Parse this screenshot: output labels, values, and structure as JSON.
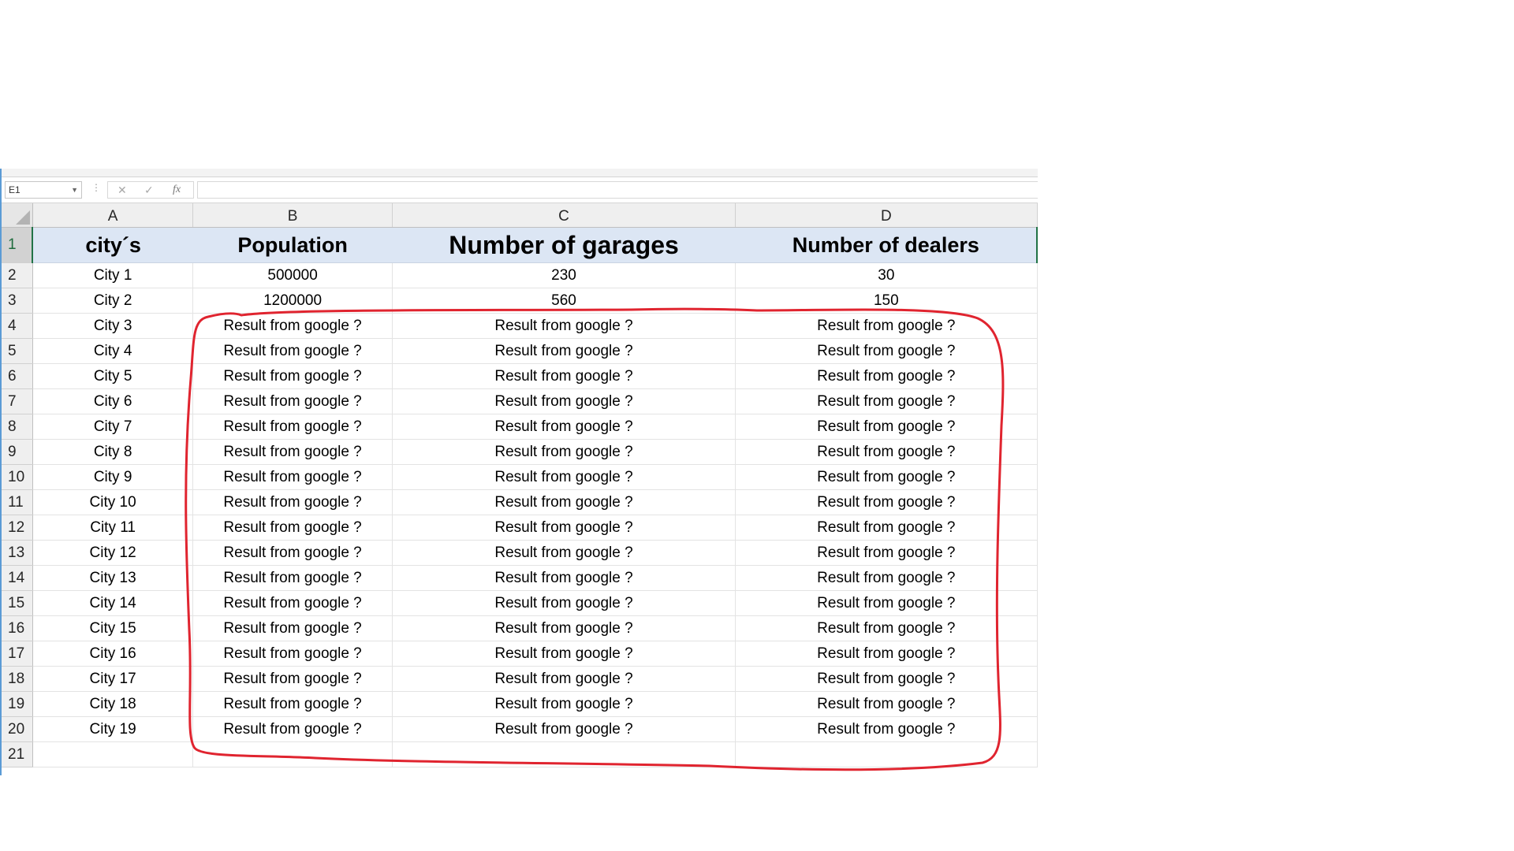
{
  "formula_bar": {
    "name_box": "E1",
    "cancel_glyph": "✕",
    "enter_glyph": "✓",
    "fx_label": "fx",
    "formula_value": ""
  },
  "sheet": {
    "columns": [
      "A",
      "B",
      "C",
      "D"
    ],
    "header_row": {
      "row_number": "1",
      "cells": [
        "city´s",
        "Population",
        "Number of garages",
        "Number of dealers"
      ]
    },
    "rows": [
      {
        "n": "2",
        "cells": [
          "City 1",
          "500000",
          "230",
          "30"
        ]
      },
      {
        "n": "3",
        "cells": [
          "City 2",
          "1200000",
          "560",
          "150"
        ]
      },
      {
        "n": "4",
        "cells": [
          "City 3",
          "Result from google ?",
          "Result from google ?",
          "Result from google ?"
        ]
      },
      {
        "n": "5",
        "cells": [
          "City 4",
          "Result from google ?",
          "Result from google ?",
          "Result from google ?"
        ]
      },
      {
        "n": "6",
        "cells": [
          "City 5",
          "Result from google ?",
          "Result from google ?",
          "Result from google ?"
        ]
      },
      {
        "n": "7",
        "cells": [
          "City 6",
          "Result from google ?",
          "Result from google ?",
          "Result from google ?"
        ]
      },
      {
        "n": "8",
        "cells": [
          "City 7",
          "Result from google ?",
          "Result from google ?",
          "Result from google ?"
        ]
      },
      {
        "n": "9",
        "cells": [
          "City 8",
          "Result from google ?",
          "Result from google ?",
          "Result from google ?"
        ]
      },
      {
        "n": "10",
        "cells": [
          "City 9",
          "Result from google ?",
          "Result from google ?",
          "Result from google ?"
        ]
      },
      {
        "n": "11",
        "cells": [
          "City 10",
          "Result from google ?",
          "Result from google ?",
          "Result from google ?"
        ]
      },
      {
        "n": "12",
        "cells": [
          "City 11",
          "Result from google ?",
          "Result from google ?",
          "Result from google ?"
        ]
      },
      {
        "n": "13",
        "cells": [
          "City 12",
          "Result from google ?",
          "Result from google ?",
          "Result from google ?"
        ]
      },
      {
        "n": "14",
        "cells": [
          "City 13",
          "Result from google ?",
          "Result from google ?",
          "Result from google ?"
        ]
      },
      {
        "n": "15",
        "cells": [
          "City 14",
          "Result from google ?",
          "Result from google ?",
          "Result from google ?"
        ]
      },
      {
        "n": "16",
        "cells": [
          "City 15",
          "Result from google ?",
          "Result from google ?",
          "Result from google ?"
        ]
      },
      {
        "n": "17",
        "cells": [
          "City 16",
          "Result from google ?",
          "Result from google ?",
          "Result from google ?"
        ]
      },
      {
        "n": "18",
        "cells": [
          "City 17",
          "Result from google ?",
          "Result from google ?",
          "Result from google ?"
        ]
      },
      {
        "n": "19",
        "cells": [
          "City 18",
          "Result from google ?",
          "Result from google ?",
          "Result from google ?"
        ]
      },
      {
        "n": "20",
        "cells": [
          "City 19",
          "Result from google ?",
          "Result from google ?",
          "Result from google ?"
        ]
      },
      {
        "n": "21",
        "cells": [
          "",
          "",
          "",
          ""
        ]
      }
    ]
  },
  "colors": {
    "header_fill": "#dce6f4",
    "selection_green": "#217346",
    "annotation_red": "#e0242f"
  }
}
